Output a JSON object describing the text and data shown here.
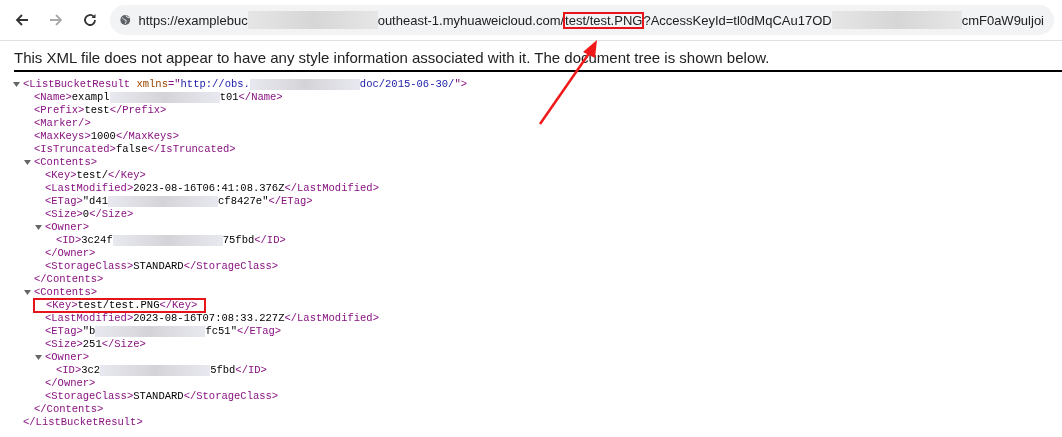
{
  "toolbar": {
    "url": [
      {
        "kind": "text",
        "text": "https://examplebuc"
      },
      {
        "kind": "redacted"
      },
      {
        "kind": "text",
        "text": "outheast-1.myhuaweicloud.com/"
      },
      {
        "kind": "text",
        "text": "test/test.PNG",
        "highlighted": true
      },
      {
        "kind": "text",
        "text": "?AccessKeyId=tl0dMqCAu17OD"
      },
      {
        "kind": "redacted"
      },
      {
        "kind": "text",
        "text": "cmF0aW9uljoi"
      }
    ]
  },
  "notice": "This XML file does not appear to have any style information associated with it. The document tree is shown below.",
  "tree": {
    "line": [
      {
        "kind": "tag",
        "text": "<ListBucketResult "
      },
      {
        "kind": "attr",
        "text": "xmlns"
      },
      {
        "kind": "tag",
        "text": "=\""
      },
      {
        "kind": "value",
        "text": "http://obs."
      },
      {
        "kind": "redacted"
      },
      {
        "kind": "value",
        "text": "doc/2015-06-30/"
      },
      {
        "kind": "tag",
        "text": "\">"
      }
    ],
    "expanded": true,
    "closing": [
      {
        "kind": "tag",
        "text": "</ListBucketResult>"
      }
    ],
    "children": [
      {
        "line": [
          {
            "kind": "tag",
            "text": "<Name>"
          },
          {
            "kind": "text",
            "text": "exampl"
          },
          {
            "kind": "redacted"
          },
          {
            "kind": "text",
            "text": "t01"
          },
          {
            "kind": "tag",
            "text": "</Name>"
          }
        ]
      },
      {
        "line": [
          {
            "kind": "tag",
            "text": "<Prefix>"
          },
          {
            "kind": "text",
            "text": "test"
          },
          {
            "kind": "tag",
            "text": "</Prefix>"
          }
        ]
      },
      {
        "line": [
          {
            "kind": "tag",
            "text": "<Marker/>"
          }
        ]
      },
      {
        "line": [
          {
            "kind": "tag",
            "text": "<MaxKeys>"
          },
          {
            "kind": "text",
            "text": "1000"
          },
          {
            "kind": "tag",
            "text": "</MaxKeys>"
          }
        ]
      },
      {
        "line": [
          {
            "kind": "tag",
            "text": "<IsTruncated>"
          },
          {
            "kind": "text",
            "text": "false"
          },
          {
            "kind": "tag",
            "text": "</IsTruncated>"
          }
        ]
      },
      {
        "line": [
          {
            "kind": "tag",
            "text": "<Contents>"
          }
        ],
        "expanded": true,
        "closing": [
          {
            "kind": "tag",
            "text": "</Contents>"
          }
        ],
        "children": [
          {
            "line": [
              {
                "kind": "tag",
                "text": "<Key>"
              },
              {
                "kind": "text",
                "text": "test/"
              },
              {
                "kind": "tag",
                "text": "</Key>"
              }
            ]
          },
          {
            "line": [
              {
                "kind": "tag",
                "text": "<LastModified>"
              },
              {
                "kind": "text",
                "text": "2023-08-16T06:41:08.376Z"
              },
              {
                "kind": "tag",
                "text": "</LastModified>"
              }
            ]
          },
          {
            "line": [
              {
                "kind": "tag",
                "text": "<ETag>"
              },
              {
                "kind": "text",
                "text": "\"d41"
              },
              {
                "kind": "redacted"
              },
              {
                "kind": "text",
                "text": "cf8427e\""
              },
              {
                "kind": "tag",
                "text": "</ETag>"
              }
            ]
          },
          {
            "line": [
              {
                "kind": "tag",
                "text": "<Size>"
              },
              {
                "kind": "text",
                "text": "0"
              },
              {
                "kind": "tag",
                "text": "</Size>"
              }
            ]
          },
          {
            "line": [
              {
                "kind": "tag",
                "text": "<Owner>"
              }
            ],
            "expanded": true,
            "closing": [
              {
                "kind": "tag",
                "text": "</Owner>"
              }
            ],
            "children": [
              {
                "line": [
                  {
                    "kind": "tag",
                    "text": "<ID>"
                  },
                  {
                    "kind": "text",
                    "text": "3c24f"
                  },
                  {
                    "kind": "redacted"
                  },
                  {
                    "kind": "text",
                    "text": "75fbd"
                  },
                  {
                    "kind": "tag",
                    "text": "</ID>"
                  }
                ]
              }
            ]
          },
          {
            "line": [
              {
                "kind": "tag",
                "text": "<StorageClass>"
              },
              {
                "kind": "text",
                "text": "STANDARD"
              },
              {
                "kind": "tag",
                "text": "</StorageClass>"
              }
            ]
          }
        ]
      },
      {
        "line": [
          {
            "kind": "tag",
            "text": "<Contents>"
          }
        ],
        "expanded": true,
        "closing": [
          {
            "kind": "tag",
            "text": "</Contents>"
          }
        ],
        "children": [
          {
            "line": [
              {
                "kind": "tag",
                "text": "<Key>"
              },
              {
                "kind": "text",
                "text": "test/test.PNG"
              },
              {
                "kind": "tag",
                "text": "</Key>"
              }
            ],
            "highlighted": true
          },
          {
            "line": [
              {
                "kind": "tag",
                "text": "<LastModified>"
              },
              {
                "kind": "text",
                "text": "2023-08-16T07:08:33.227Z"
              },
              {
                "kind": "tag",
                "text": "</LastModified>"
              }
            ]
          },
          {
            "line": [
              {
                "kind": "tag",
                "text": "<ETag>"
              },
              {
                "kind": "text",
                "text": "\"b"
              },
              {
                "kind": "redacted"
              },
              {
                "kind": "text",
                "text": "fc51\""
              },
              {
                "kind": "tag",
                "text": "</ETag>"
              }
            ]
          },
          {
            "line": [
              {
                "kind": "tag",
                "text": "<Size>"
              },
              {
                "kind": "text",
                "text": "251"
              },
              {
                "kind": "tag",
                "text": "</Size>"
              }
            ]
          },
          {
            "line": [
              {
                "kind": "tag",
                "text": "<Owner>"
              }
            ],
            "expanded": true,
            "closing": [
              {
                "kind": "tag",
                "text": "</Owner>"
              }
            ],
            "children": [
              {
                "line": [
                  {
                    "kind": "tag",
                    "text": "<ID>"
                  },
                  {
                    "kind": "text",
                    "text": "3c2"
                  },
                  {
                    "kind": "redacted"
                  },
                  {
                    "kind": "text",
                    "text": "5fbd"
                  },
                  {
                    "kind": "tag",
                    "text": "</ID>"
                  }
                ]
              }
            ]
          },
          {
            "line": [
              {
                "kind": "tag",
                "text": "<StorageClass>"
              },
              {
                "kind": "text",
                "text": "STANDARD"
              },
              {
                "kind": "tag",
                "text": "</StorageClass>"
              }
            ]
          }
        ]
      }
    ]
  }
}
